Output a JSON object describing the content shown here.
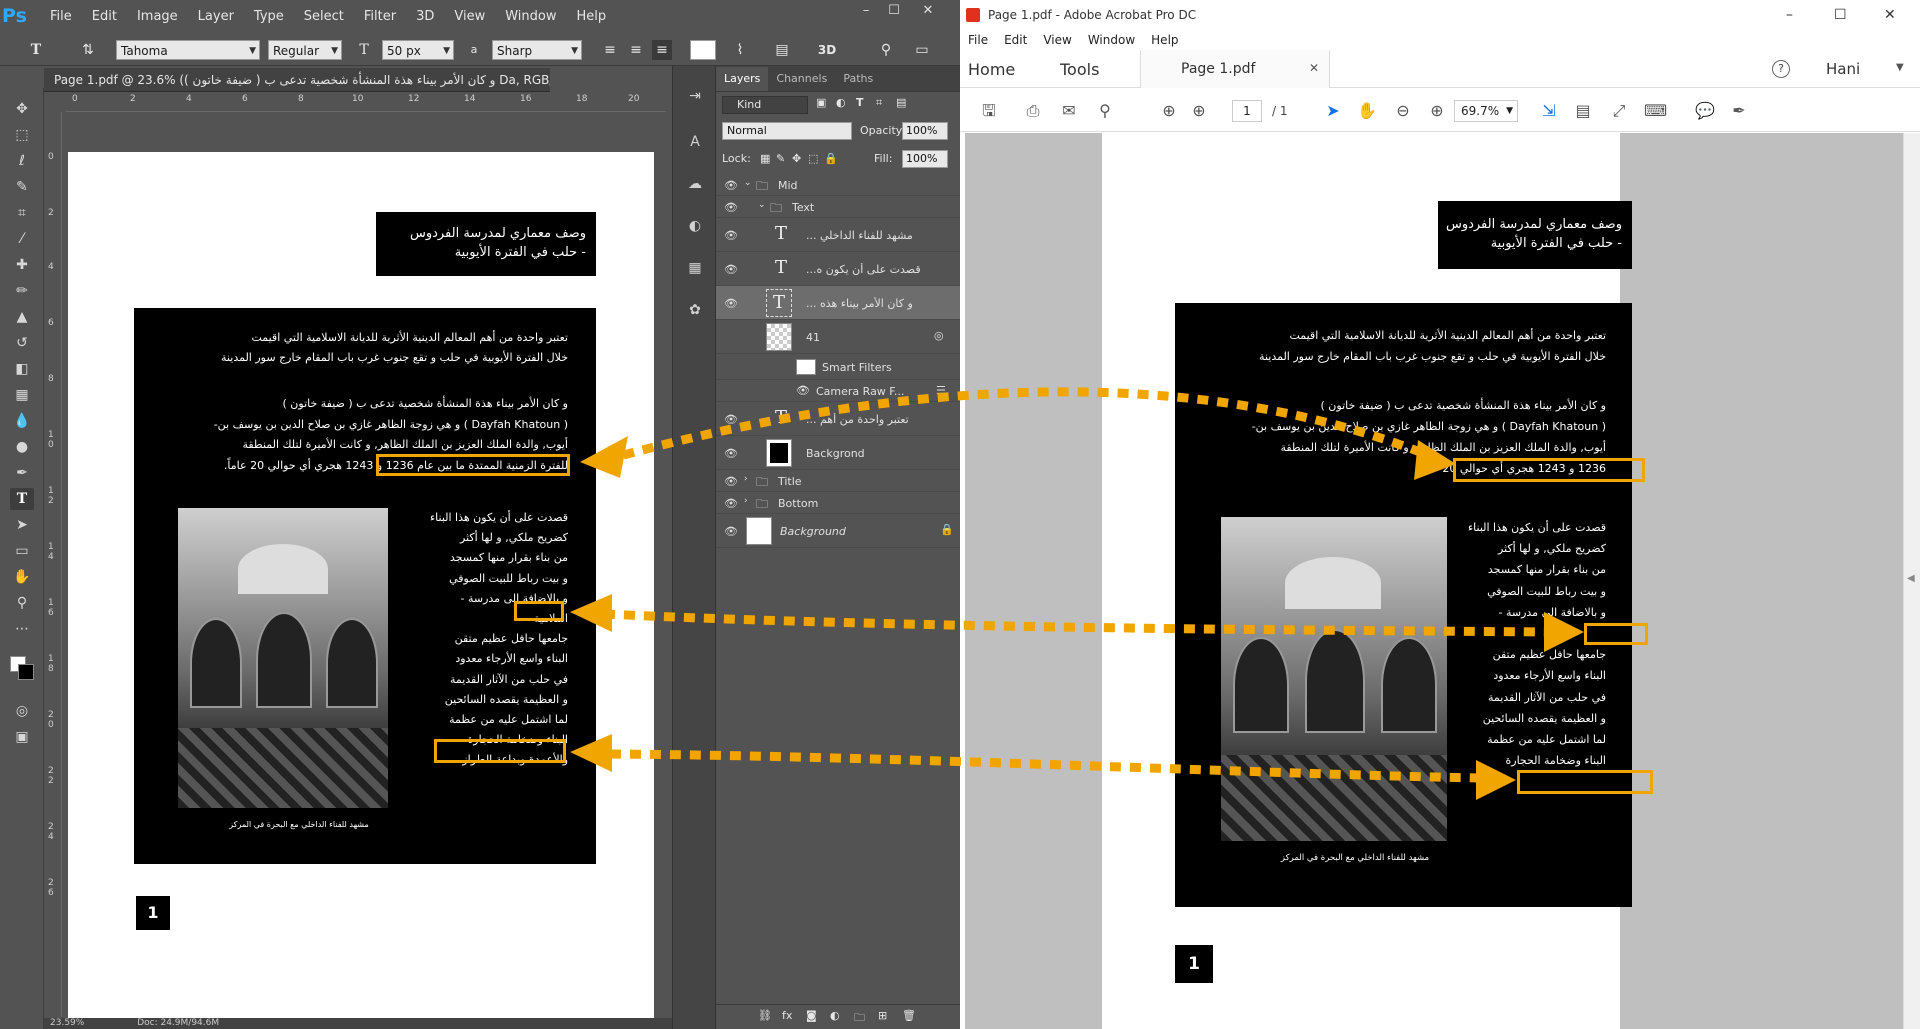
{
  "photoshop": {
    "logo": "Ps",
    "menu": [
      "File",
      "Edit",
      "Image",
      "Layer",
      "Type",
      "Select",
      "Filter",
      "3D",
      "View",
      "Window",
      "Help"
    ],
    "window_controls": [
      "–",
      "☐",
      "✕"
    ],
    "options": {
      "font_family": "Tahoma",
      "font_style": "Regular",
      "font_size": "50 px",
      "aa_prefix": "a",
      "antialias": "Sharp"
    },
    "doc_tab": "Page 1.pdf @ 23.6% (و كان الأمر بيناء هذة المنشأة شخصية تدعى ب ( ضيفة خاتون ) Da, RGB/8)",
    "doc_tab_close": "×",
    "ruler_top": [
      "0",
      "2",
      "4",
      "6",
      "8",
      "10",
      "12",
      "14",
      "16",
      "18",
      "20"
    ],
    "ruler_left": [
      "0",
      "2",
      "4",
      "6",
      "8",
      "1\n0",
      "1\n2",
      "1\n4",
      "1\n6",
      "1\n8",
      "2\n0",
      "2\n2",
      "2\n4",
      "2\n6"
    ],
    "status_zoom": "23.59%",
    "status_doc": "Doc: 24.9M/94.6M",
    "page": {
      "title_text": "وصف معماري لمدرسة الفردوس\n- حلب في الفترة الأيوبية",
      "para1": "تعتبر واحدة من أهم المعالم الدينية الأثرية للديانة الاسلامية التي اقيمت\nخلال الفترة الأيوبية في حلب و تقع جنوب غرب باب المقام خارج سور المدينة",
      "para2": "و كان الأمر بيناء هذة المنشأة شخصية تدعى ب ( ضيفة خاتون )\n( Dayfah Khatoun ) و هي زوجة الظاهر غازي بن صلاح الدين بن يوسف بن-\nأيوب, والدة الملك العزيز بن الملك الظاهر, و كانت الأميرة لتلك المنطقة\nللفترة الزمنية الممتدة ما بين عام 1236 و 1243 هجري أي حوالي 20 عاماً.",
      "para3": "قصدت على أن يكون هذا البناء\nكضريح ملكي, و لها أكثر\nمن بناء بقرار منها كمسجد\nو بيت رباط للبيت الصوفي\nو بالاضافة الى مدرسة -\nاسلامية\nجامعها حافل عظيم متقن\nالبناء واسع الأرجاء معدود\nفي حلب من الآثار القديمة\nو العظيمة يقصده السائحين\nلما اشتمل عليه من عظمة\nالبناء وضخامة الحجارة\nوالأعمدة وبداعة الطراز.",
      "caption": "مشهد للفناء الداخلي مع البحرة في المركز",
      "page_number": "1"
    },
    "layers_panel": {
      "tabs": [
        "Layers",
        "Channels",
        "Paths"
      ],
      "filter": "Kind",
      "blend": "Normal",
      "opacity_label": "Opacity:",
      "opacity": "100%",
      "lock_label": "Lock:",
      "fill_label": "Fill:",
      "fill": "100%",
      "rows": [
        {
          "name": "Mid",
          "type": "group"
        },
        {
          "name": "Text",
          "type": "group"
        },
        {
          "name": "مشهد للفناء الداخلي ...",
          "type": "text"
        },
        {
          "name": "قصدت على أن يكون ه...",
          "type": "text"
        },
        {
          "name": "و كان الأمر بيناء هذه ...",
          "type": "text"
        },
        {
          "name": "41",
          "type": "smart"
        },
        {
          "name": "Smart Filters",
          "type": "filter"
        },
        {
          "name": "Camera Raw F...",
          "type": "filter"
        },
        {
          "name": "تعتبر واحدة من أهم ...",
          "type": "text"
        },
        {
          "name": "Backgrond",
          "type": "fill"
        },
        {
          "name": "Title",
          "type": "group"
        },
        {
          "name": "Bottom",
          "type": "group"
        },
        {
          "name": "Background",
          "type": "background"
        }
      ]
    }
  },
  "acrobat": {
    "title": "Page 1.pdf - Adobe Acrobat Pro DC",
    "menu": [
      "File",
      "Edit",
      "View",
      "Window",
      "Help"
    ],
    "nav_home": "Home",
    "nav_tools": "Tools",
    "doc_tab": "Page 1.pdf",
    "user": "Hani",
    "page_current": "1",
    "page_total": "/ 1",
    "zoom": "69.7%",
    "window_controls": [
      "–",
      "☐",
      "✕"
    ],
    "page": {
      "title_text": "وصف معماري لمدرسة الفردوس\n- حلب في الفترة الأيوبية",
      "para1": "تعتبر واحدة من أهم المعالم الدينية الأثرية للديانة الاسلامية التي اقيمت\nخلال الفترة الأيوبية في حلب و تقع جنوب غرب باب المقام خارج سور المدينة",
      "para2": "و كان الأمر بيناء هذة المنشأة شخصية تدعى ب ( ضيفة خاتون )\n( Dayfah Khatoun ) و هي زوجة الظاهر غازي بن صلاح الدين بن يوسف بن-\nأيوب, والدة الملك العزيز بن الملك الظاهر, و كانت الأميرة لتلك المنطقة\n1236 و 1243 هجري أي حوالي 20 عاماً.",
      "para3": "قصدت على أن يكون هذا البناء\nكضريح ملكي, و لها أكثر\nمن بناء بقرار منها كمسجد\nو بيت رباط للبيت الصوفي\nو بالاضافة الى مدرسة -\n\nجامعها حافل عظيم متقن\nالبناء واسع الأرجاء معدود\nفي حلب من الآثار القديمة\nو العظيمة يقصده السائحين\nلما اشتمل عليه من عظمة\nالبناء وضخامة الحجارة",
      "caption": "مشهد للفناء الداخلي مع البحرة في المركز",
      "page_number": "1"
    }
  },
  "colors": {
    "annotation": "#f0a500",
    "ps_bg": "#535353",
    "ps_accent": "#31a8ff"
  }
}
